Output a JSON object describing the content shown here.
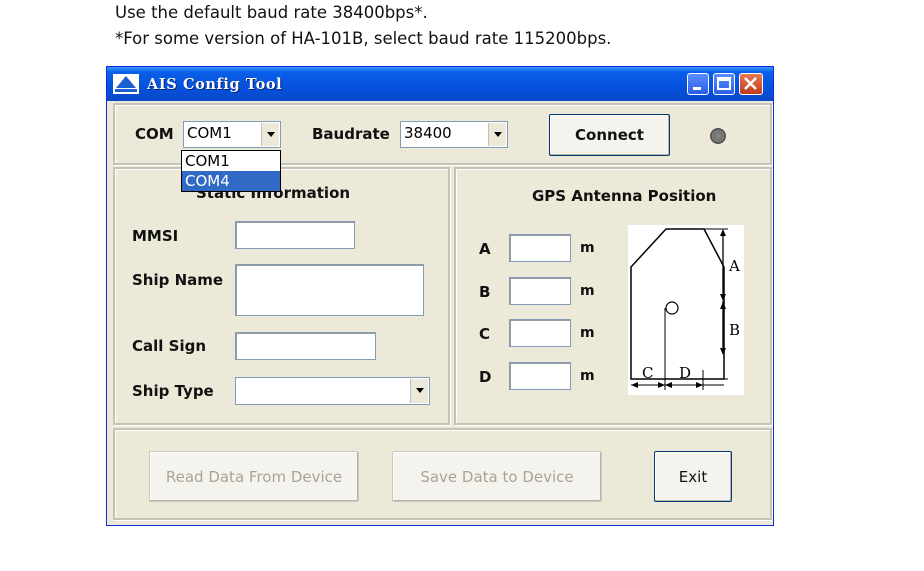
{
  "doc": {
    "line1": "Use the default baud rate 38400bps*.",
    "line2": "*For some version of HA-101B, select baud rate 115200bps."
  },
  "window": {
    "title": "AIS Config Tool",
    "icon": "app-icon"
  },
  "connection": {
    "com_label": "COM",
    "com_value": "COM1",
    "com_options": [
      "COM1",
      "COM4"
    ],
    "com_highlighted": "COM4",
    "baud_label": "Baudrate",
    "baud_value": "38400",
    "connect_label": "Connect",
    "status_led": "off"
  },
  "static_info": {
    "title": "Static Information",
    "mmsi_label": "MMSI",
    "mmsi_value": "",
    "ship_name_label": "Ship Name",
    "ship_name_value": "",
    "call_sign_label": "Call Sign",
    "call_sign_value": "",
    "ship_type_label": "Ship Type",
    "ship_type_value": ""
  },
  "gps": {
    "title": "GPS Antenna Position",
    "fields": [
      {
        "label": "A",
        "unit": "m",
        "value": ""
      },
      {
        "label": "B",
        "unit": "m",
        "value": ""
      },
      {
        "label": "C",
        "unit": "m",
        "value": ""
      },
      {
        "label": "D",
        "unit": "m",
        "value": ""
      }
    ],
    "diagram_labels": {
      "a": "A",
      "b": "B",
      "c": "C",
      "d": "D"
    }
  },
  "actions": {
    "read_label": "Read Data From Device",
    "save_label": "Save Data to Device",
    "exit_label": "Exit"
  },
  "colors": {
    "titlebar": "#0551de",
    "dialog_bg": "#ece9d8",
    "selection": "#316ac5"
  }
}
